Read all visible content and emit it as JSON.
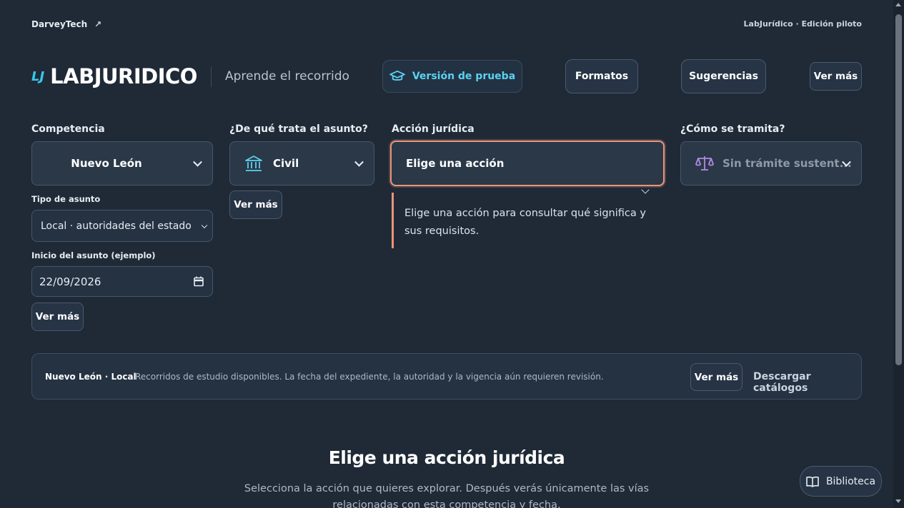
{
  "topbar": {
    "brand": "DarveyTech",
    "brand_icon": "external-link-icon",
    "edition": "LabJurídico · Edición piloto"
  },
  "header": {
    "logo_mark": "LJ",
    "logo_text": "LABJURIDICO",
    "tagline": "Aprende el recorrido",
    "trial_button": "Versión de prueba",
    "formats_button": "Formatos",
    "suggestions_button": "Sugerencias",
    "more_button": "Ver más"
  },
  "filters": {
    "competencia": {
      "label": "Competencia",
      "value": "Nuevo León"
    },
    "tipo_asunto": {
      "label": "Tipo de asunto",
      "value": "Local · autoridades del estado"
    },
    "inicio": {
      "label": "Inicio del asunto (ejemplo)",
      "value": "22/09/2026"
    },
    "more_left": "Ver más",
    "materia": {
      "label": "¿De qué trata el asunto?",
      "value": "Civil",
      "more": "Ver más"
    },
    "accion": {
      "label": "Acción jurídica",
      "value": "Elige una acción",
      "hint": "Elige una acción para consultar qué significa y sus requisitos."
    },
    "tramite": {
      "label": "¿Cómo se tramita?",
      "value": "Sin trámite sustent..."
    }
  },
  "info_bar": {
    "location": "Nuevo León · Local",
    "message": "Recorridos de estudio disponibles. La fecha del expediente, la autoridad y la vigencia aún requieren revisión.",
    "more": "Ver más",
    "download": "Descargar catálogos"
  },
  "main": {
    "title": "Elige una acción jurídica",
    "subtitle_line1": "Selecciona la acción que quieres explorar. Después verás únicamente las vías",
    "subtitle_line2": "relacionadas con esta competencia y fecha."
  },
  "floating": {
    "library_button": "Biblioteca"
  },
  "colors": {
    "background": "#1f2a36",
    "accent": "#5ad2f0",
    "focus_border": "#e8957a",
    "scale_icon": "#b08ae0"
  }
}
